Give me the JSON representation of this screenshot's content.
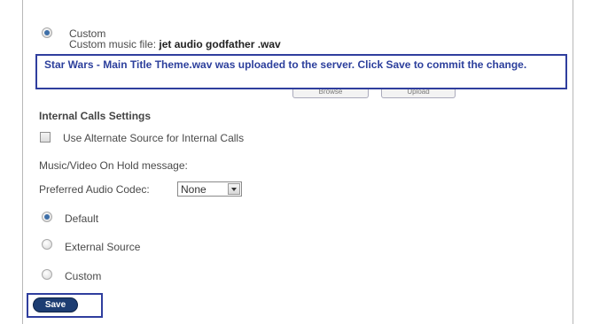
{
  "custom_top": {
    "option_label": "Custom",
    "music_file_label": "Custom music file:",
    "music_file_name": "jet audio godfather .wav"
  },
  "upload_notice": {
    "text": "Star Wars - Main Title Theme.wav was uploaded to the server. Click Save to commit the change."
  },
  "hidden_buttons": {
    "browse_label": "Browse",
    "upload_label": "Upload"
  },
  "internal_calls": {
    "heading": "Internal Calls Settings",
    "alternate_source_label": "Use Alternate Source for Internal Calls",
    "alternate_source_checked": false,
    "hold_message_label": "Music/Video On Hold message:",
    "codec_label": "Preferred Audio Codec:",
    "codec_value": "None",
    "options": [
      {
        "label": "Default",
        "checked": true
      },
      {
        "label": "External Source",
        "checked": false
      },
      {
        "label": "Custom",
        "checked": false
      }
    ]
  },
  "actions": {
    "save_label": "Save"
  },
  "colors": {
    "highlight_border": "#2f3e9e",
    "notice_text": "#2c3f9c",
    "save_button": "#1d3d72",
    "radio_dot": "#3e6fa8"
  }
}
